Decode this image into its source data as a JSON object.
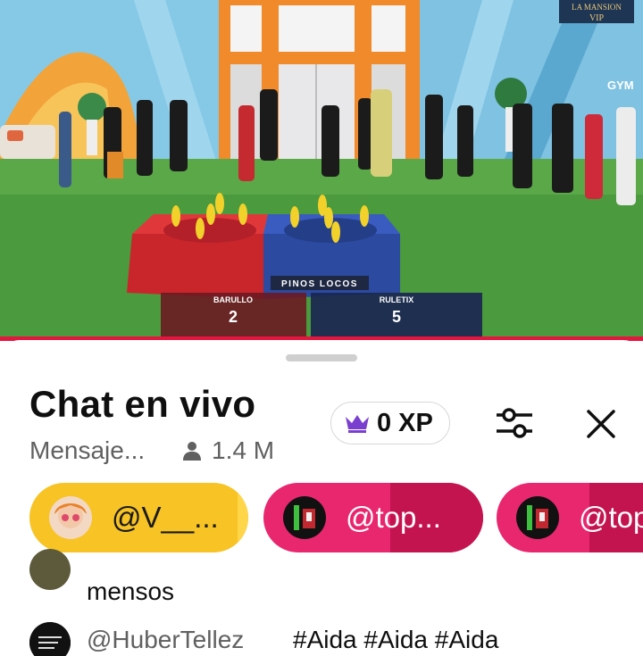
{
  "video": {
    "corner_logo_line1": "LA MANSION",
    "corner_logo_line2": "VIP",
    "gym_sign": "GYM",
    "game_name": "PINOS LOCOS",
    "scores": [
      {
        "team": "BARULLO",
        "score": "2"
      },
      {
        "team": "RULETIX",
        "score": "5"
      }
    ],
    "colors": {
      "red_team": "#c8262b",
      "blue_team": "#2b4aa0",
      "progress": "#e4163f"
    }
  },
  "chat": {
    "title": "Chat en vivo",
    "subtitle": "Mensaje...",
    "viewer_count": "1.4 M",
    "xp_label": "0 XP",
    "icons": {
      "xp": "crown-icon",
      "filter": "sliders-icon",
      "close": "close-icon",
      "viewers": "person-icon"
    },
    "pinned_chips": [
      {
        "name": "@V__...",
        "color": "#f7c325"
      },
      {
        "name": "@top...",
        "color": "#e8276e"
      },
      {
        "name": "@top",
        "color": "#e8276e"
      }
    ],
    "messages": [
      {
        "author": "",
        "text": "mensos"
      },
      {
        "author": "@HuberTellez",
        "text": "#Aida #Aida #Aida"
      }
    ]
  }
}
